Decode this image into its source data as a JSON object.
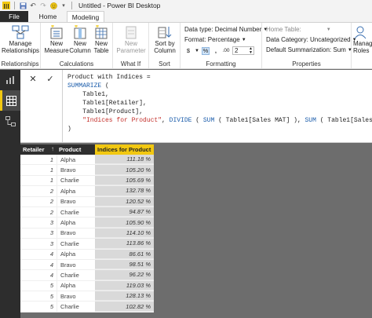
{
  "window": {
    "title": "Untitled - Power BI Desktop"
  },
  "tabs": {
    "file": "File",
    "home": "Home",
    "modeling": "Modeling"
  },
  "ribbon": {
    "relationships": {
      "manage": "Manage Relationships",
      "group": "Relationships"
    },
    "calculations": {
      "new_measure": "New Measure",
      "new_column": "New Column",
      "new_table": "New Table",
      "group": "Calculations"
    },
    "whatif": {
      "new_parameter": "New Parameter",
      "group": "What If"
    },
    "sort": {
      "sort_by_column": "Sort by Column",
      "group": "Sort"
    },
    "formatting": {
      "data_type": "Data type: Decimal Number",
      "format": "Format: Percentage",
      "currency_symbol": "$",
      "percent_symbol": "%",
      "comma_symbol": ",",
      "decimal_symbol": ".00",
      "decimal_places": "2",
      "group": "Formatting"
    },
    "properties": {
      "home_table": "Home Table:",
      "data_category": "Data Category: Uncategorized",
      "default_summarization": "Default Summarization: Sum",
      "group": "Properties"
    },
    "manage_roles": "Manage Roles"
  },
  "formula": {
    "line1": "Product with Indices =",
    "line2_kw": "SUMMARIZE",
    "line2_rest": " (",
    "line3": "    Table1,",
    "line4": "    Table1[Retailer],",
    "line5": "    Table1[Product],",
    "line6_str": "\"Indices for Product\"",
    "line6_a": ", ",
    "line6_kw1": "DIVIDE",
    "line6_b": " ( ",
    "line6_kw2": "SUM",
    "line6_c": " ( Table1[Sales MAT] ), ",
    "line6_kw3": "SUM",
    "line6_d": " ( Table1[Sales MAT-1] ) )",
    "line7": ")"
  },
  "table": {
    "columns": [
      "Retailer",
      "Product",
      "Indices for Product"
    ],
    "rows": [
      [
        "1",
        "Alpha",
        "111.18 %"
      ],
      [
        "1",
        "Bravo",
        "105.20 %"
      ],
      [
        "1",
        "Charlie",
        "105.69 %"
      ],
      [
        "2",
        "Alpha",
        "132.78 %"
      ],
      [
        "2",
        "Bravo",
        "120.52 %"
      ],
      [
        "2",
        "Charlie",
        "94.87 %"
      ],
      [
        "3",
        "Alpha",
        "105.90 %"
      ],
      [
        "3",
        "Bravo",
        "114.10 %"
      ],
      [
        "3",
        "Charlie",
        "113.86 %"
      ],
      [
        "4",
        "Alpha",
        "86.61 %"
      ],
      [
        "4",
        "Bravo",
        "98.51 %"
      ],
      [
        "4",
        "Charlie",
        "96.22 %"
      ],
      [
        "5",
        "Alpha",
        "119.03 %"
      ],
      [
        "5",
        "Bravo",
        "128.13 %"
      ],
      [
        "5",
        "Charlie",
        "102.82 %"
      ]
    ]
  },
  "colors": {
    "accent": "#f2c811",
    "keyword": "#1b5dab",
    "string": "#c4302b"
  },
  "icons": [
    "save-icon",
    "undo-icon",
    "redo-icon",
    "smiley-icon",
    "report-view-icon",
    "data-view-icon",
    "relationship-view-icon",
    "cancel-icon",
    "commit-icon"
  ]
}
